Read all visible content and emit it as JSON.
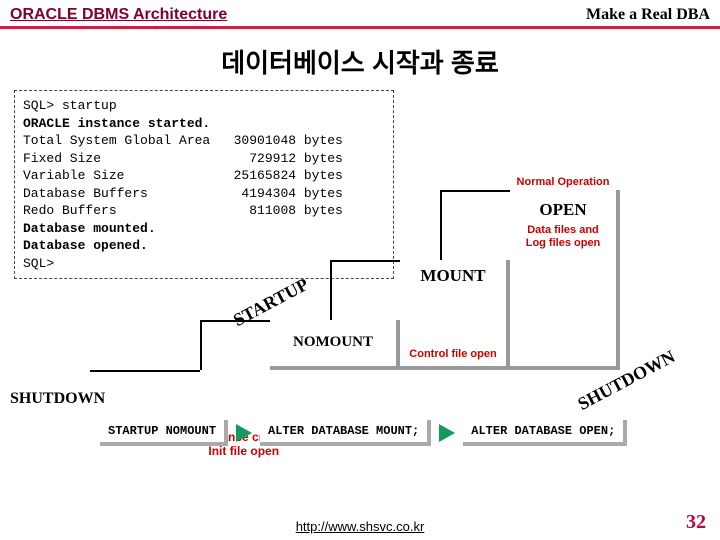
{
  "header": {
    "left": "ORACLE DBMS Architecture",
    "right": "Make a Real DBA"
  },
  "title": "데이터베이스 시작과 종료",
  "sql": {
    "l1": "SQL> startup",
    "l2": "ORACLE instance started.",
    "l3": "Total System Global Area   30901048 bytes",
    "l4": "Fixed Size                   729912 bytes",
    "l5": "Variable Size              25165824 bytes",
    "l6": "Database Buffers            4194304 bytes",
    "l7": "Redo Buffers                 811008 bytes",
    "l8": "Database mounted.",
    "l9": "Database opened.",
    "l10": "SQL>"
  },
  "steps": {
    "open": {
      "cap": "Normal Operation",
      "label": "OPEN",
      "cap2a": "Data files and",
      "cap2b": "Log files open"
    },
    "mount": {
      "label": "MOUNT",
      "cap": "Control file open"
    },
    "nomount": {
      "label": "NOMOUNT"
    }
  },
  "annot": {
    "startup": "STARTUP",
    "shutdown_big": "SHUTDOWN",
    "instance1": "Instance create",
    "instance2": "Init file open",
    "shutdown_small": "SHUTDOWN"
  },
  "cmds": {
    "c1": "STARTUP NOMOUNT",
    "c2": "ALTER DATABASE MOUNT;",
    "c3": "ALTER DATABASE OPEN;"
  },
  "footer": {
    "url": "http://www.shsvc.co.kr",
    "page": "32"
  }
}
